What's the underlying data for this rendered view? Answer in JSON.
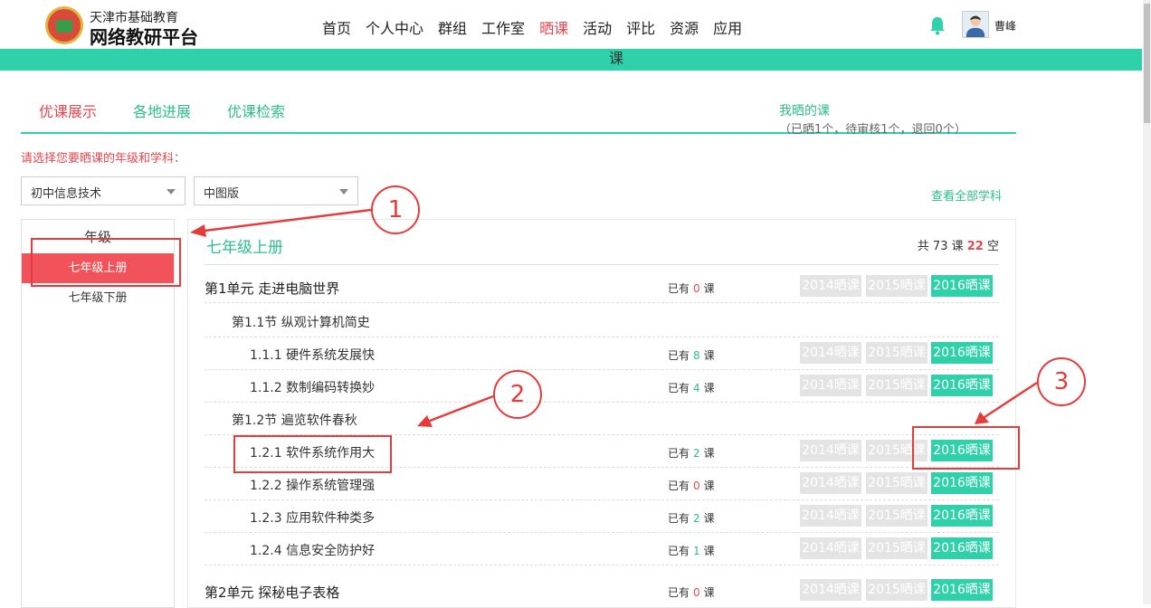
{
  "header": {
    "logo_line1": "天津市基础教育",
    "logo_line2": "网络教研平台",
    "nav": [
      "首页",
      "个人中心",
      "群组",
      "工作室",
      "晒课",
      "活动",
      "评比",
      "资源",
      "应用"
    ],
    "active_nav": "晒课",
    "username": "曹峰",
    "band_text": "课"
  },
  "tabs": {
    "items": [
      "优课展示",
      "各地进展",
      "优课检索"
    ],
    "mine_label": "我晒的课",
    "mine_stats": "（已晒1个，待审核1个，退回0个）"
  },
  "filter": {
    "prompt": "请选择您要晒课的年级和学科：",
    "subject": "初中信息技术",
    "edition": "中图版",
    "view_all": "查看全部学科"
  },
  "grades": {
    "title": "年级",
    "items": [
      "七年级上册",
      "七年级下册"
    ]
  },
  "content": {
    "volume_title": "七年级上册",
    "total_prefix": "共 73 课",
    "empty_count": "22",
    "empty_suffix": "空",
    "have_label": "已有",
    "lesson_label": "课",
    "btn_2014": "2014晒课",
    "btn_2015": "2015晒课",
    "btn_2016": "2016晒课",
    "rows": [
      {
        "type": "unit",
        "label": "第1单元 走进电脑世界",
        "count": "0"
      },
      {
        "type": "section",
        "label": "第1.1节 纵观计算机简史"
      },
      {
        "type": "lesson",
        "label": "1.1.1 硬件系统发展快",
        "count": "8"
      },
      {
        "type": "lesson",
        "label": "1.1.2 数制编码转换妙",
        "count": "4"
      },
      {
        "type": "section",
        "label": "第1.2节 遍览软件春秋"
      },
      {
        "type": "lesson",
        "label": "1.2.1 软件系统作用大",
        "count": "2"
      },
      {
        "type": "lesson",
        "label": "1.2.2 操作系统管理强",
        "count": "0"
      },
      {
        "type": "lesson",
        "label": "1.2.3 应用软件种类多",
        "count": "2"
      },
      {
        "type": "lesson",
        "label": "1.2.4 信息安全防护好",
        "count": "1"
      },
      {
        "type": "unit",
        "label": "第2单元 探秘电子表格",
        "count": "0"
      }
    ]
  },
  "annotations": [
    "1",
    "2",
    "3"
  ],
  "colors": {
    "accent_green": "#2ed1a9",
    "accent_red": "#e4474e",
    "annotation_red": "#e63b3b"
  }
}
